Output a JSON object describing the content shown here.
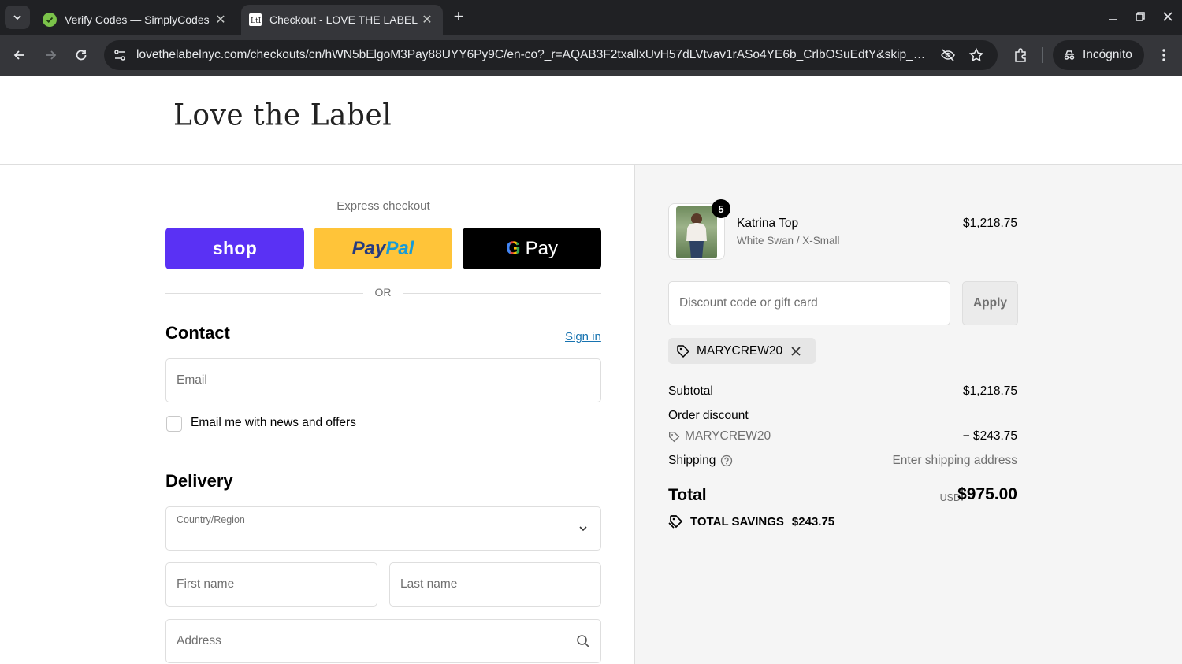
{
  "browser": {
    "tabs": [
      {
        "title": "Verify Codes — SimplyCodes",
        "favicon": "simplycodes-icon"
      },
      {
        "title": "Checkout - LOVE THE LABEL",
        "favicon": "ltl-icon"
      }
    ],
    "url": "lovethelabelnyc.com/checkouts/cn/hWN5bElgoM3Pay88UYY6Py9C/en-co?_r=AQAB3F2txallxUvH57dLVtvav1rASo4YE6b_CrlbOSuEdtY&skip_sho...",
    "incognito_label": "Incógnito"
  },
  "store": {
    "logo_text": "Love the Label"
  },
  "checkout": {
    "express_label": "Express checkout",
    "shop_label": "shop",
    "paypal_part1": "Pay",
    "paypal_part2": "Pal",
    "gpay_g": "G",
    "gpay_label": "Pay",
    "or_label": "OR",
    "contact_title": "Contact",
    "signin_label": "Sign in",
    "email_placeholder": "Email",
    "newsletter_label": "Email me with news and offers",
    "delivery_title": "Delivery",
    "country_label": "Country/Region",
    "country_value": "",
    "first_name_placeholder": "First name",
    "last_name_placeholder": "Last name",
    "address_placeholder": "Address"
  },
  "summary": {
    "item": {
      "name": "Katrina Top",
      "variant": "White Swan / X-Small",
      "price": "$1,218.75",
      "quantity": "5"
    },
    "discount_placeholder": "Discount code or gift card",
    "apply_label": "Apply",
    "applied_code": "MARYCREW20",
    "subtotal_label": "Subtotal",
    "subtotal_value": "$1,218.75",
    "order_discount_label": "Order discount",
    "discount_code": "MARYCREW20",
    "discount_value": "− $243.75",
    "shipping_label": "Shipping",
    "shipping_value": "Enter shipping address",
    "total_label": "Total",
    "total_currency": "USD",
    "total_value": "$975.00",
    "savings_label": "TOTAL SAVINGS",
    "savings_value": "$243.75"
  },
  "colors": {
    "shop_pay": "#5a31f4",
    "paypal": "#ffc439",
    "link": "#1773b0",
    "summary_bg": "#f5f5f5"
  }
}
